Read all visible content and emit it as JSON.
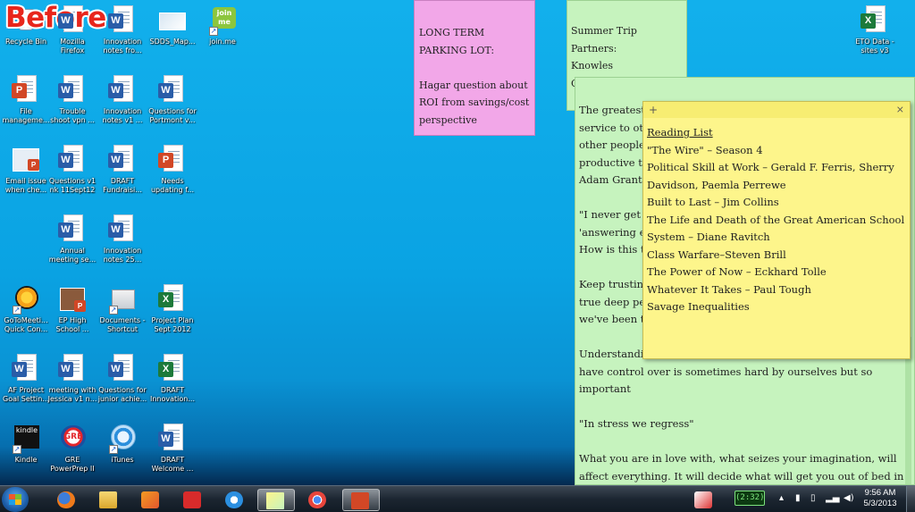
{
  "overlay": {
    "caption": "Before"
  },
  "desktop_icons": [
    {
      "name": "recycle-bin",
      "label": "Recycle Bin"
    },
    {
      "name": "mozilla-firefox",
      "label": "Mozilla\nFirefox"
    },
    {
      "name": "innovation-notes-fro",
      "label": "Innovation\nnotes fro..."
    },
    {
      "name": "sdds-map",
      "label": "SDDS_Map..."
    },
    {
      "name": "joinme",
      "label": "join.me"
    },
    {
      "name": "file-manageme",
      "label": "File\nmanageme..."
    },
    {
      "name": "trouble-shoot-vpn",
      "label": "Trouble\nshoot vpn ..."
    },
    {
      "name": "innovation-notes-v1",
      "label": "Innovation\nnotes v1 ..."
    },
    {
      "name": "questions-for-portmont",
      "label": "Questions for\nPortmont v..."
    },
    {
      "name": "email-issue",
      "label": "Email issue\nwhen che..."
    },
    {
      "name": "questions-v1",
      "label": "Questions v1\nnk 11Sept12"
    },
    {
      "name": "draft-fundraisi",
      "label": "DRAFT\nFundraisi..."
    },
    {
      "name": "needs-updating",
      "label": "Needs\nupdating f..."
    },
    {
      "name": "annual-meeting",
      "label": "Annual\nmeeting se..."
    },
    {
      "name": "innovation-notes-25",
      "label": "Innovation\nnotes 25..."
    },
    {
      "name": "gotomeeting",
      "label": "GoToMeeti...\nQuick Con..."
    },
    {
      "name": "ep-high-school",
      "label": "EP High\nSchool ..."
    },
    {
      "name": "documents-shortcut",
      "label": "Documents -\nShortcut"
    },
    {
      "name": "project-plan",
      "label": "Project Plan\nSept 2012"
    },
    {
      "name": "af-project",
      "label": "AF Project\nGoal Settin..."
    },
    {
      "name": "meeting-with-jessica",
      "label": "meeting with\nJessica v1 n..."
    },
    {
      "name": "questions-junior",
      "label": "Questions for\njunior achie..."
    },
    {
      "name": "draft-innovation",
      "label": "DRAFT\nInnovation..."
    },
    {
      "name": "kindle",
      "label": "Kindle"
    },
    {
      "name": "gre-powerprep",
      "label": "GRE\nPowerPrep II"
    },
    {
      "name": "itunes",
      "label": "iTunes"
    },
    {
      "name": "draft-welcome",
      "label": "DRAFT\nWelcome ..."
    },
    {
      "name": "eto-data",
      "label": "ETO Data -\nsites v3"
    }
  ],
  "notes": {
    "pink": {
      "lines": [
        "LONG TERM",
        "PARKING LOT:",
        "",
        "Hagar question about",
        "ROI from savings/cost",
        "perspective"
      ]
    },
    "green_small": {
      "lines": [
        "Summer Trip",
        "Partners:",
        "Knowles",
        "C"
      ]
    },
    "green_large": {
      "lines": [
        "The greatest",
        "service to oth",
        "other people",
        "productive th",
        "Adam Grant",
        "",
        "\"I never get",
        "'answering e",
        "How is this t",
        "",
        "Keep trusting",
        "true deep pe",
        "we've been t",
        "",
        "Understandi",
        "have control over is sometimes hard by ourselves but so",
        "important",
        "",
        "\"In stress we regress\"",
        "",
        "What you are in love with, what seizes your imagination, will",
        "affect everything. It will decide what will get you out of bed in"
      ]
    },
    "yellow": {
      "add_glyph": "+",
      "close_glyph": "×",
      "title": "Reading List",
      "lines": [
        "\"The Wire\" – Season 4",
        "Political Skill at Work – Gerald F. Ferris, Sherry",
        "Davidson, Paemla Perrewe",
        "Built to Last – Jim Collins",
        "The Life and Death of the Great American School",
        "System – Diane Ravitch",
        "Class Warfare–Steven Brill",
        "The Power of Now – Eckhard Tolle",
        "Whatever It Takes – Paul Tough",
        "Savage Inequalities"
      ]
    }
  },
  "taskbar": {
    "items": [
      "start",
      "firefox",
      "explorer",
      "media-player",
      "shopping",
      "internet-explorer",
      "sticky-notes",
      "chrome",
      "powerpoint"
    ],
    "battery": "(2:32)",
    "time": "9:56 AM",
    "date": "5/3/2013"
  },
  "colors": {
    "desktop": "#0aa6e6",
    "pink_note": "#f2a7e8",
    "green_note": "#c6f3be",
    "yellow_note": "#fdf58b"
  }
}
